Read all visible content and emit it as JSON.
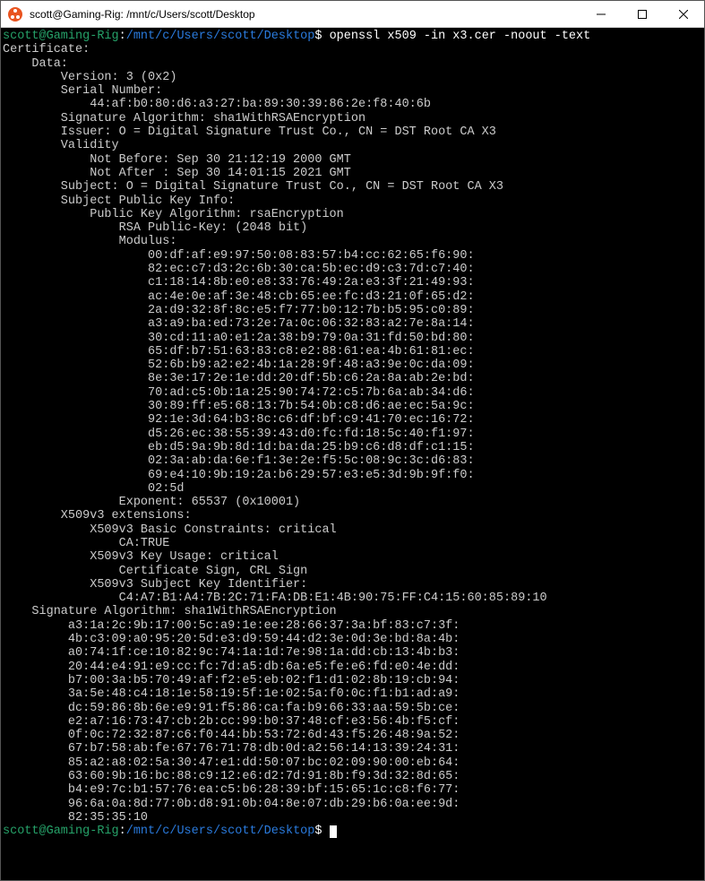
{
  "window": {
    "title": "scott@Gaming-Rig: /mnt/c/Users/scott/Desktop"
  },
  "prompt": {
    "user_host": "scott@Gaming-Rig",
    "colon": ":",
    "path": "/mnt/c/Users/scott/Desktop",
    "dollar": "$ "
  },
  "command": "openssl x509 -in x3.cer -noout -text",
  "output": {
    "l00": "Certificate:",
    "l01": "    Data:",
    "l02": "        Version: 3 (0x2)",
    "l03": "        Serial Number:",
    "l04": "            44:af:b0:80:d6:a3:27:ba:89:30:39:86:2e:f8:40:6b",
    "l05": "        Signature Algorithm: sha1WithRSAEncryption",
    "l06": "        Issuer: O = Digital Signature Trust Co., CN = DST Root CA X3",
    "l07": "        Validity",
    "l08": "            Not Before: Sep 30 21:12:19 2000 GMT",
    "l09": "            Not After : Sep 30 14:01:15 2021 GMT",
    "l10": "        Subject: O = Digital Signature Trust Co., CN = DST Root CA X3",
    "l11": "        Subject Public Key Info:",
    "l12": "            Public Key Algorithm: rsaEncryption",
    "l13": "                RSA Public-Key: (2048 bit)",
    "l14": "                Modulus:",
    "l15": "                    00:df:af:e9:97:50:08:83:57:b4:cc:62:65:f6:90:",
    "l16": "                    82:ec:c7:d3:2c:6b:30:ca:5b:ec:d9:c3:7d:c7:40:",
    "l17": "                    c1:18:14:8b:e0:e8:33:76:49:2a:e3:3f:21:49:93:",
    "l18": "                    ac:4e:0e:af:3e:48:cb:65:ee:fc:d3:21:0f:65:d2:",
    "l19": "                    2a:d9:32:8f:8c:e5:f7:77:b0:12:7b:b5:95:c0:89:",
    "l20": "                    a3:a9:ba:ed:73:2e:7a:0c:06:32:83:a2:7e:8a:14:",
    "l21": "                    30:cd:11:a0:e1:2a:38:b9:79:0a:31:fd:50:bd:80:",
    "l22": "                    65:df:b7:51:63:83:c8:e2:88:61:ea:4b:61:81:ec:",
    "l23": "                    52:6b:b9:a2:e2:4b:1a:28:9f:48:a3:9e:0c:da:09:",
    "l24": "                    8e:3e:17:2e:1e:dd:20:df:5b:c6:2a:8a:ab:2e:bd:",
    "l25": "                    70:ad:c5:0b:1a:25:90:74:72:c5:7b:6a:ab:34:d6:",
    "l26": "                    30:89:ff:e5:68:13:7b:54:0b:c8:d6:ae:ec:5a:9c:",
    "l27": "                    92:1e:3d:64:b3:8c:c6:df:bf:c9:41:70:ec:16:72:",
    "l28": "                    d5:26:ec:38:55:39:43:d0:fc:fd:18:5c:40:f1:97:",
    "l29": "                    eb:d5:9a:9b:8d:1d:ba:da:25:b9:c6:d8:df:c1:15:",
    "l30": "                    02:3a:ab:da:6e:f1:3e:2e:f5:5c:08:9c:3c:d6:83:",
    "l31": "                    69:e4:10:9b:19:2a:b6:29:57:e3:e5:3d:9b:9f:f0:",
    "l32": "                    02:5d",
    "l33": "                Exponent: 65537 (0x10001)",
    "l34": "        X509v3 extensions:",
    "l35": "            X509v3 Basic Constraints: critical",
    "l36": "                CA:TRUE",
    "l37": "            X509v3 Key Usage: critical",
    "l38": "                Certificate Sign, CRL Sign",
    "l39": "            X509v3 Subject Key Identifier:",
    "l40": "                C4:A7:B1:A4:7B:2C:71:FA:DB:E1:4B:90:75:FF:C4:15:60:85:89:10",
    "l41": "    Signature Algorithm: sha1WithRSAEncryption",
    "l42": "         a3:1a:2c:9b:17:00:5c:a9:1e:ee:28:66:37:3a:bf:83:c7:3f:",
    "l43": "         4b:c3:09:a0:95:20:5d:e3:d9:59:44:d2:3e:0d:3e:bd:8a:4b:",
    "l44": "         a0:74:1f:ce:10:82:9c:74:1a:1d:7e:98:1a:dd:cb:13:4b:b3:",
    "l45": "         20:44:e4:91:e9:cc:fc:7d:a5:db:6a:e5:fe:e6:fd:e0:4e:dd:",
    "l46": "         b7:00:3a:b5:70:49:af:f2:e5:eb:02:f1:d1:02:8b:19:cb:94:",
    "l47": "         3a:5e:48:c4:18:1e:58:19:5f:1e:02:5a:f0:0c:f1:b1:ad:a9:",
    "l48": "         dc:59:86:8b:6e:e9:91:f5:86:ca:fa:b9:66:33:aa:59:5b:ce:",
    "l49": "         e2:a7:16:73:47:cb:2b:cc:99:b0:37:48:cf:e3:56:4b:f5:cf:",
    "l50": "         0f:0c:72:32:87:c6:f0:44:bb:53:72:6d:43:f5:26:48:9a:52:",
    "l51": "         67:b7:58:ab:fe:67:76:71:78:db:0d:a2:56:14:13:39:24:31:",
    "l52": "         85:a2:a8:02:5a:30:47:e1:dd:50:07:bc:02:09:90:00:eb:64:",
    "l53": "         63:60:9b:16:bc:88:c9:12:e6:d2:7d:91:8b:f9:3d:32:8d:65:",
    "l54": "         b4:e9:7c:b1:57:76:ea:c5:b6:28:39:bf:15:65:1c:c8:f6:77:",
    "l55": "         96:6a:0a:8d:77:0b:d8:91:0b:04:8e:07:db:29:b6:0a:ee:9d:",
    "l56": "         82:35:35:10"
  }
}
